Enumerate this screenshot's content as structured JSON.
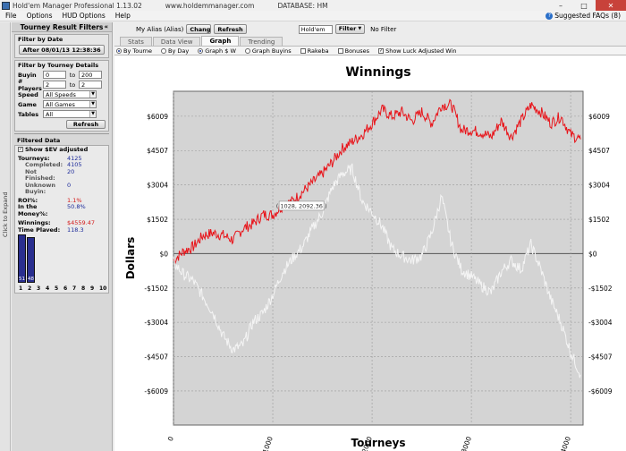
{
  "window": {
    "title": "Hold'em Manager Professional 1.13.02",
    "site": "www.holdemmanager.com",
    "database": "DATABASE: HM",
    "btn_min": "–",
    "btn_max": "□",
    "btn_close": "✕"
  },
  "menu": {
    "file": "File",
    "options": "Options",
    "hud_options": "HUD Options",
    "help": "Help"
  },
  "faq": {
    "label": "Suggested FAQs (8)",
    "icon": "question-icon"
  },
  "expand_label": "Click to Expand",
  "sidebar": {
    "title": "Tourney Result Filters",
    "collapse": "«",
    "date_group": "Filter by Date",
    "date_button": "After 08/01/13 12:38:36",
    "details_group": "Filter by Tourney Details",
    "buyin_label": "Buyin",
    "buyin_min": "0",
    "buyin_max": "200",
    "players_label": "# Players",
    "players_min": "2",
    "players_max": "2",
    "to": "to",
    "speed_label": "Speed",
    "speed_value": "All Speeds",
    "game_label": "Game",
    "game_value": "All Games",
    "tables_label": "Tables",
    "tables_value": "All",
    "refresh": "Refresh",
    "filtered_title": "Filtered Data",
    "show_ev": "Show $EV adjusted",
    "stats": [
      {
        "k": "Tourneys:",
        "v": "4125",
        "red": false
      },
      {
        "k": "Completed:",
        "v": "4105",
        "red": false
      },
      {
        "k": "Not Finished:",
        "v": "20",
        "red": false
      },
      {
        "k": "Unknown",
        "v": "0",
        "red": false
      },
      {
        "k": "Buyin:",
        "v": "",
        "red": false
      }
    ],
    "roi_label": "ROI%:",
    "roi_value": "1.1%",
    "itm_label": "In the Money%:",
    "itm_value": "50.8%",
    "winnings_label": "Winnings:",
    "winnings_value": "$4559.47",
    "time_label": "Time Played:",
    "time_value": "118.3",
    "bars": [
      {
        "pos": 1,
        "label": "51",
        "pct": 51
      },
      {
        "pos": 2,
        "label": "48",
        "pct": 48
      }
    ],
    "bar_positions": [
      "1",
      "2",
      "3",
      "4",
      "5",
      "6",
      "7",
      "8",
      "9",
      "10"
    ]
  },
  "toolbar": {
    "alias_label": "My Alias (Alias)",
    "change_btn": "Chang e",
    "refresh_btn": "Refresh",
    "game_combo": "Hold'em",
    "filter_btn": "Filter",
    "filter_status": "No Filter"
  },
  "tabs": [
    "Stats",
    "Data View",
    "Graph",
    "Trending"
  ],
  "active_tab": "Graph",
  "options": {
    "by_tourney": "By Tourne",
    "by_day": "By Day",
    "graph_win": "Graph $ W",
    "graph_buyins": "Graph Buyins",
    "rakeba": "Rakeba",
    "bonuses": "Bonuses",
    "show_luck": "Show Luck Adjusted Win"
  },
  "chart_data": {
    "type": "line",
    "title": "Winnings",
    "xlabel": "Tourneys",
    "ylabel": "Dollars",
    "xlim": [
      0,
      4125
    ],
    "ylim": [
      -7500,
      7100
    ],
    "xticks": [
      0,
      1000,
      2000,
      3000,
      4000
    ],
    "yticks": [
      6009,
      4507,
      3004,
      1502,
      0,
      -1502,
      -3004,
      -4507,
      -6009
    ],
    "ytick_labels": [
      "$6009",
      "$4507",
      "$3004",
      "$1502",
      "$0",
      "-$1502",
      "-$3004",
      "-$4507",
      "-$6009"
    ],
    "grid": true,
    "tooltip": "( 1028, 2092.36 )",
    "series": [
      {
        "color": "#e8141a",
        "x": [
          0,
          100,
          200,
          300,
          400,
          500,
          600,
          700,
          800,
          900,
          1000,
          1100,
          1200,
          1300,
          1400,
          1500,
          1600,
          1700,
          1800,
          1900,
          2000,
          2100,
          2200,
          2300,
          2400,
          2500,
          2600,
          2700,
          2800,
          2900,
          3000,
          3100,
          3200,
          3300,
          3400,
          3500,
          3600,
          3700,
          3800,
          3900,
          4000,
          4100
        ],
        "y": [
          -300,
          100,
          300,
          800,
          900,
          800,
          600,
          1100,
          1300,
          1700,
          1700,
          2100,
          2300,
          2700,
          3100,
          3500,
          4000,
          4600,
          4900,
          5200,
          5700,
          6300,
          6000,
          6200,
          5800,
          6200,
          5700,
          6500,
          6500,
          5400,
          5400,
          5300,
          5100,
          5800,
          5100,
          5800,
          6500,
          6200,
          5700,
          6000,
          5200,
          5000
        ]
      },
      {
        "color": "#f4f4f4",
        "x": [
          0,
          100,
          200,
          300,
          400,
          500,
          600,
          700,
          800,
          900,
          1000,
          1100,
          1200,
          1300,
          1400,
          1500,
          1600,
          1700,
          1800,
          1900,
          2000,
          2100,
          2200,
          2300,
          2400,
          2500,
          2600,
          2700,
          2800,
          2900,
          3000,
          3100,
          3200,
          3300,
          3400,
          3500,
          3600,
          3700,
          3800,
          3900,
          4000,
          4100
        ],
        "y": [
          -400,
          -900,
          -1200,
          -1900,
          -2600,
          -3600,
          -4200,
          -4000,
          -3000,
          -2600,
          -1800,
          -800,
          -200,
          300,
          1100,
          1800,
          2900,
          3500,
          3700,
          2300,
          1800,
          1200,
          200,
          -100,
          -300,
          -100,
          900,
          2500,
          400,
          -700,
          -1000,
          -1400,
          -1700,
          -800,
          -300,
          -700,
          400,
          -700,
          -2000,
          -3000,
          -4300,
          -5300
        ]
      }
    ]
  }
}
